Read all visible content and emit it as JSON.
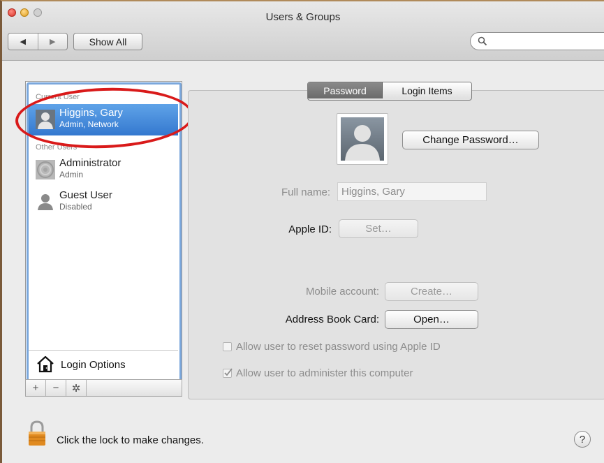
{
  "window": {
    "title": "Users & Groups"
  },
  "toolbar": {
    "back_glyph": "◀",
    "forward_glyph": "▶",
    "show_all_label": "Show All",
    "search_placeholder": ""
  },
  "sidebar": {
    "current_user_header": "Current User",
    "other_users_header": "Other Users",
    "current_user": {
      "name": "Higgins, Gary",
      "role": "Admin, Network",
      "icon": "user-silhouette-icon"
    },
    "other_users": [
      {
        "name": "Administrator",
        "role": "Admin",
        "icon": "user-texture-icon"
      },
      {
        "name": "Guest User",
        "role": "Disabled",
        "icon": "user-silhouette-icon"
      }
    ],
    "login_options_label": "Login Options",
    "add_glyph": "+",
    "remove_glyph": "−",
    "gear_glyph": "✲"
  },
  "tabs": {
    "password": "Password",
    "login_items": "Login Items",
    "active": "Password"
  },
  "main": {
    "change_password_label": "Change Password…",
    "full_name_label": "Full name:",
    "full_name_value": "Higgins, Gary",
    "apple_id_label": "Apple ID:",
    "apple_id_button": "Set…",
    "mobile_account_label": "Mobile account:",
    "mobile_account_button": "Create…",
    "address_book_label": "Address Book Card:",
    "address_book_button": "Open…",
    "allow_reset_label": "Allow user to reset password using Apple ID",
    "allow_reset_checked": false,
    "allow_admin_label": "Allow user to administer this computer",
    "allow_admin_checked": true
  },
  "footer": {
    "lock_text": "Click the lock to make changes.",
    "help_glyph": "?"
  },
  "colors": {
    "selection": "#3d85d6",
    "annotation_circle": "#d91a1a"
  }
}
